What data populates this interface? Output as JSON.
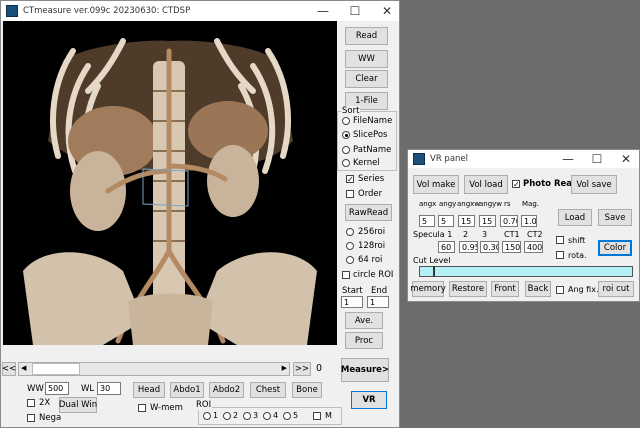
{
  "main_window": {
    "title": "CTmeasure ver.099c 20230630: CTDSP",
    "side_buttons": {
      "read": "Read",
      "ww": "WW",
      "clear": "Clear",
      "one_file": "1-File"
    },
    "sort": {
      "group_label": "Sort",
      "options": [
        "FileName",
        "SlicePos",
        "PatName",
        "Kernel"
      ],
      "selected": "SlicePos"
    },
    "series_label": "Series",
    "order_label": "Order",
    "rawread_label": "RawRead",
    "roi_options": [
      "256roi",
      "128roi",
      "64 roi"
    ],
    "circle_roi_label": "circle ROI",
    "start_label": "Start",
    "end_label": "End",
    "start_value": "1",
    "end_value": "1",
    "ave_label": "Ave.",
    "proc_label": "Proc",
    "measure_label": "Measure>",
    "vr_label": "VR",
    "nav": {
      "left_label": "<<",
      "right_label": ">>",
      "slice_index": "0"
    },
    "ww_label": "WW",
    "ww_value": "500",
    "wl_label": "WL",
    "wl_value": "30",
    "presets": [
      "Head",
      "Abdo1",
      "Abdo2",
      "Chest",
      "Bone"
    ],
    "zoom2x_label": "2X",
    "dualwin_label": "Dual Win",
    "nega_label": "Nega",
    "wmem_label": "W-mem",
    "roi_group_label": "ROI",
    "roi_radios": [
      "1",
      "2",
      "3",
      "4",
      "5"
    ],
    "roi_m_label": "M"
  },
  "vr_panel": {
    "title": "VR panel",
    "vol_make": "Vol make",
    "vol_load": "Vol load",
    "photo_real": "Photo Real",
    "photo_real_checked": true,
    "vol_save": "Vol save",
    "param_labels": [
      "angx",
      "angy",
      "angxw",
      "angyw",
      "rs",
      "Mag."
    ],
    "param_values": [
      "5",
      "5",
      "15",
      "15",
      "0.70",
      "1.0"
    ],
    "load": "Load",
    "save": "Save",
    "specula_label": "Specula 1",
    "spec_labels": [
      "2",
      "3",
      "CT1",
      "CT2"
    ],
    "spec_values": [
      "60",
      "0.95",
      "0.30",
      "150",
      "400"
    ],
    "shift_label": "shift",
    "rota_label": "rota.",
    "color_label": "Color",
    "cut_level_label": "Cut Level",
    "memory": "memory",
    "restore": "Restore",
    "front": "Front",
    "back": "Back",
    "ang_fix": "Ang fix.",
    "roi_cut": "roi cut"
  }
}
